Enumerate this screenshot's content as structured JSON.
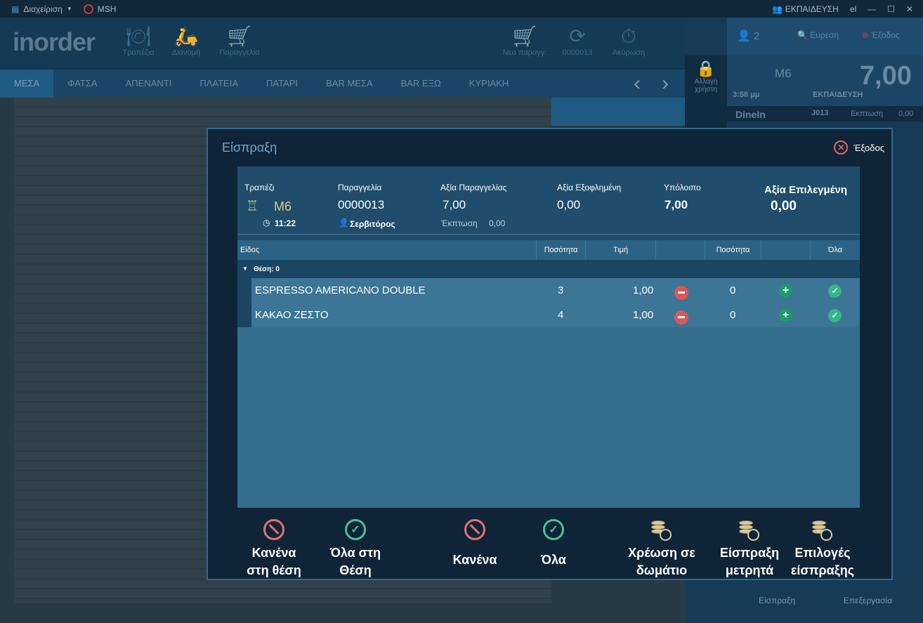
{
  "topbar": {
    "menu_label": "Διαχείριση",
    "user_code": "MSH",
    "user_name": "ΕΚΠΑΙΔΕΥΣΗ",
    "lang": "el"
  },
  "app": {
    "logo": "inorder"
  },
  "toolbar": {
    "tables_label": "Τραπέζια",
    "delivery_label": "Διανομή",
    "orders_label": "Παραγγελία",
    "new_label": "Νεα παραγγ.",
    "order_code": "0000013",
    "cancel_label": "Ακύρωση"
  },
  "area_tabs": [
    "ΜΕΣΑ",
    "ΦΑΤΣΑ",
    "ΑΠΕΝΑΝΤΙ",
    "ΠΛΑΤΕΙΑ",
    "ΠΑΤΑΡΙ",
    "BAR ΜΕΣΑ",
    "BAR ΕΞΩ",
    "ΚΥΡΙΑΚΗ"
  ],
  "sidebar": {
    "guests": "2",
    "search_label": "Ευρεση",
    "exit_label": "Έξοδος",
    "table": "M6",
    "total": "7,00",
    "time": "3:58 μμ",
    "user": "ΕΚΠΑΙΔΕΥΣΗ",
    "mode": "DineIn",
    "order_suffix": "J013",
    "discount_label": "Εκπτωση",
    "discount": "0,00",
    "lock_label": "Αλλαγή χρήστη",
    "pay_label": "Είσπραξη",
    "edit_label": "Επεξεργασία"
  },
  "modal": {
    "title": "Είσπραξη",
    "exit_label": "Έξοδος",
    "summary": {
      "table_label": "Τραπέζι",
      "table": "M6",
      "time": "11:22",
      "order_label": "Παραγγελία",
      "order": "0000013",
      "waiter": "Σερβιτόρος",
      "order_value_label": "Αξία Παραγγελίας",
      "order_value": "7,00",
      "discount_label": "Έκπτωση",
      "discount": "0,00",
      "paid_label": "Αξία Εξοφλημένη",
      "paid": "0,00",
      "remaining_label": "Υπόλοιπο",
      "remaining": "7,00",
      "selected_label": "Αξία Επιλεγμένη",
      "selected": "0,00"
    },
    "columns": {
      "item": "Είδος",
      "qty": "Ποσότητα",
      "price": "Τιμή",
      "sel_qty": "Ποσότητα",
      "all": "Όλα"
    },
    "group_label": "Θέση: 0",
    "rows": [
      {
        "name": "ESPRESSO AMERICANO DOUBLE",
        "qty": "3",
        "price": "1,00",
        "sel_qty": "0"
      },
      {
        "name": "ΚΑΚΑΟ ΖΕΣΤΟ",
        "qty": "4",
        "price": "1,00",
        "sel_qty": "0"
      }
    ],
    "buttons": {
      "none_seat_1": "Κανένα",
      "none_seat_2": "στη θέση",
      "all_seat_1": "Όλα στη",
      "all_seat_2": "Θέση",
      "none": "Κανένα",
      "all": "Όλα",
      "room_1": "Χρέωση σε",
      "room_2": "δωμάτιο",
      "cash_1": "Είσπραξη",
      "cash_2": "μετρητά",
      "options_1": "Επιλογές",
      "options_2": "είσπραξης"
    }
  }
}
